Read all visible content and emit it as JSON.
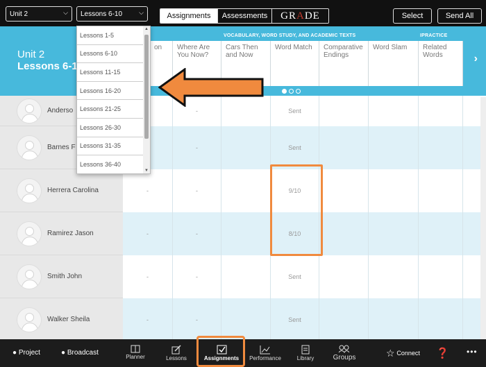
{
  "topbar": {
    "unit_select": "Unit 2",
    "lessons_select": "Lessons 6-10",
    "tabs": [
      "Assignments",
      "Assessments"
    ],
    "grade_logo": "GRADE",
    "select_button": "Select",
    "send_all_button": "Send All"
  },
  "header": {
    "unit_label": "Unit 2",
    "lessons_label": "Lessons 6-1",
    "group_label_vocab": "VOCABULARY, WORD STUDY, AND ACADEMIC TEXTS",
    "group_label_ipractice": "IPRACTICE",
    "columns": [
      "on\nmes",
      "Where Are\nYou Now?",
      "Cars Then\nand Now",
      "Word Match",
      "Comparative\nEndings",
      "Word Slam",
      "Related\nWords"
    ],
    "next_glyph": "›"
  },
  "dropdown": {
    "options": [
      "Lessons 1-5",
      "Lessons 6-10",
      "Lessons 11-15",
      "Lessons 16-20",
      "Lessons 21-25",
      "Lessons 26-30",
      "Lessons 31-35",
      "Lessons 36-40"
    ]
  },
  "students": [
    {
      "name": "Anderso",
      "cells": [
        "",
        "-",
        "",
        "Sent",
        "",
        "",
        ""
      ]
    },
    {
      "name": "Barnes F",
      "cells": [
        "",
        "-",
        "",
        "Sent",
        "",
        "",
        ""
      ]
    },
    {
      "name": "Herrera Carolina",
      "cells": [
        "-",
        "-",
        "",
        "9/10",
        "",
        "",
        ""
      ]
    },
    {
      "name": "Ramirez Jason",
      "cells": [
        "-",
        "-",
        "",
        "8/10",
        "",
        "",
        ""
      ]
    },
    {
      "name": "Smith John",
      "cells": [
        "-",
        "-",
        "",
        "Sent",
        "",
        "",
        ""
      ]
    },
    {
      "name": "Walker Sheila",
      "cells": [
        "-",
        "-",
        "",
        "Sent",
        "",
        "",
        ""
      ]
    }
  ],
  "bottombar": {
    "project": "Project",
    "broadcast": "Broadcast",
    "nav": [
      "Planner",
      "Lessons",
      "Assignments",
      "Performance",
      "Library",
      "Groups"
    ],
    "connect": "Connect",
    "more": "•••"
  },
  "colors": {
    "header_blue": "#47b9dc",
    "highlight_orange": "#f08a3e",
    "toolbar": "#111111"
  }
}
